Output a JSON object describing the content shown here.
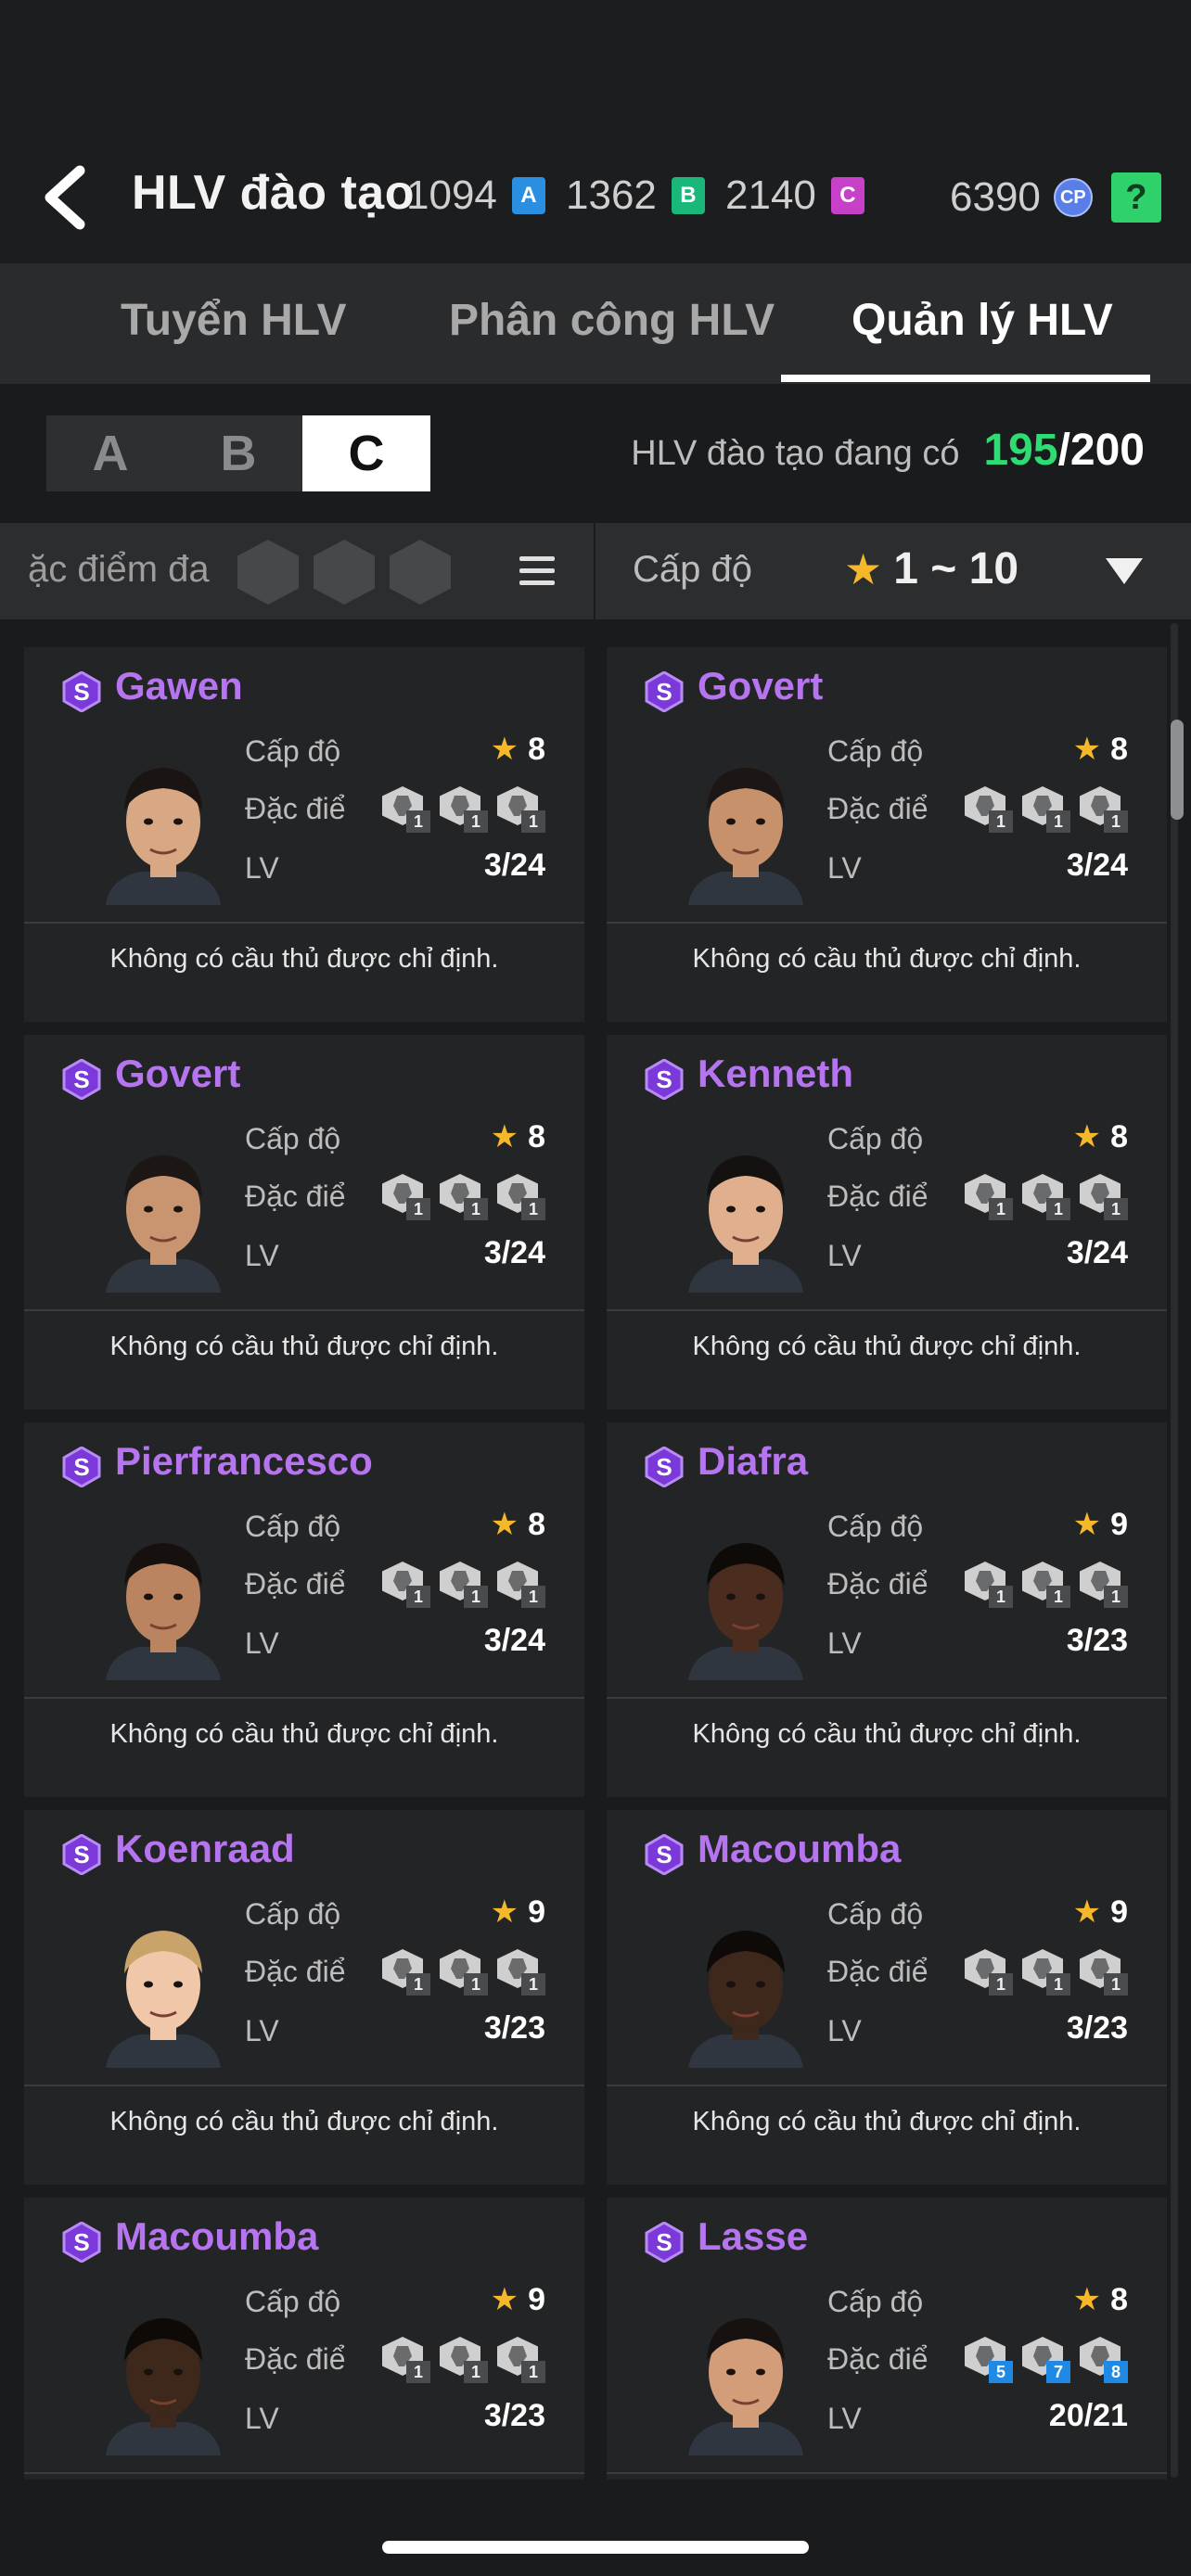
{
  "header": {
    "title": "HLV đào tạo",
    "currencies": [
      {
        "value": "1094",
        "badge": "A",
        "color": "#2a8fe0"
      },
      {
        "value": "1362",
        "badge": "B",
        "color": "#19b77a"
      },
      {
        "value": "2140",
        "badge": "C",
        "color": "#c640c8"
      }
    ],
    "cp_value": "6390",
    "cp_label": "CP",
    "help": "?"
  },
  "tabs": [
    "Tuyển HLV",
    "Phân công  HLV",
    "Quản lý HLV"
  ],
  "grades": [
    "A",
    "B",
    "C"
  ],
  "owned": {
    "label": "HLV đào tạo đang có",
    "count": "195",
    "total": "/200"
  },
  "filter": {
    "traits_label": "ặc điểm đa",
    "level_label": "Cấp độ",
    "level_range": "1 ~ 10"
  },
  "labels": {
    "level": "Cấp độ",
    "trait": "Đặc điểm",
    "trait_cut": "Đặc điểm",
    "lv": "LV",
    "footer": "Không có cầu thủ được chỉ định."
  },
  "coaches": [
    {
      "name": "Gawen",
      "level": "8",
      "lv": "3/24",
      "traits": [
        "1",
        "1",
        "1"
      ],
      "skin": "#d8a784",
      "hair": "#1a1412"
    },
    {
      "name": "Govert",
      "level": "8",
      "lv": "3/24",
      "traits": [
        "1",
        "1",
        "1"
      ],
      "skin": "#c7916c",
      "hair": "#1c1714"
    },
    {
      "name": "Govert",
      "level": "8",
      "lv": "3/24",
      "traits": [
        "1",
        "1",
        "1"
      ],
      "skin": "#c99570",
      "hair": "#1c1714"
    },
    {
      "name": "Kenneth",
      "level": "8",
      "lv": "3/24",
      "traits": [
        "1",
        "1",
        "1"
      ],
      "skin": "#e0b08e",
      "hair": "#141110"
    },
    {
      "name": "Pierfrancesco",
      "level": "8",
      "lv": "3/24",
      "traits": [
        "1",
        "1",
        "1"
      ],
      "skin": "#b9845f",
      "hair": "#16110e"
    },
    {
      "name": "Diafra",
      "level": "9",
      "lv": "3/23",
      "traits": [
        "1",
        "1",
        "1"
      ],
      "skin": "#4a2d1f",
      "hair": "#0e0a08"
    },
    {
      "name": "Koenraad",
      "level": "9",
      "lv": "3/23",
      "traits": [
        "1",
        "1",
        "1"
      ],
      "skin": "#f0c7a8",
      "hair": "#c9a36a"
    },
    {
      "name": "Macoumba",
      "level": "9",
      "lv": "3/23",
      "traits": [
        "1",
        "1",
        "1"
      ],
      "skin": "#3e271b",
      "hair": "#0e0a08"
    },
    {
      "name": "Macoumba",
      "level": "9",
      "lv": "3/23",
      "traits": [
        "1",
        "1",
        "1"
      ],
      "skin": "#3e271b",
      "hair": "#0e0a08"
    },
    {
      "name": "Lasse",
      "level": "8",
      "lv": "20/21",
      "traits": [
        "5",
        "7",
        "8"
      ],
      "skin": "#d49d7a",
      "hair": "#17120f"
    }
  ]
}
